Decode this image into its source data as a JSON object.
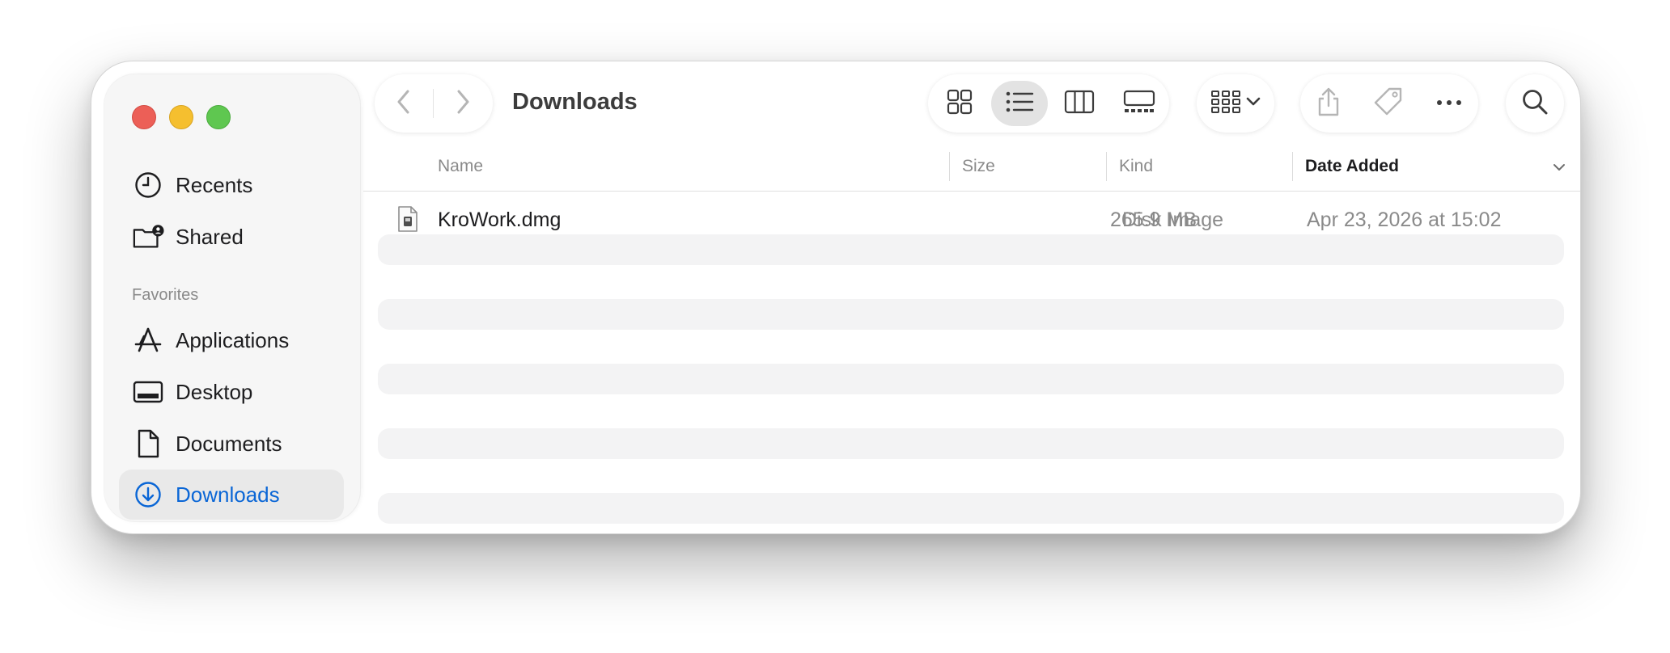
{
  "window": {
    "title": "Downloads"
  },
  "sidebar": {
    "items_top": [
      {
        "label": "Recents",
        "icon": "clock-icon"
      },
      {
        "label": "Shared",
        "icon": "shared-folder-icon"
      }
    ],
    "favorites_header": "Favorites",
    "favorites": [
      {
        "label": "Applications",
        "icon": "applications-icon"
      },
      {
        "label": "Desktop",
        "icon": "desktop-icon"
      },
      {
        "label": "Documents",
        "icon": "document-icon"
      },
      {
        "label": "Downloads",
        "icon": "downloads-icon",
        "selected": true
      }
    ]
  },
  "toolbar": {
    "view_modes": [
      "icon-view-icon",
      "list-view-icon",
      "column-view-icon",
      "gallery-view-icon"
    ],
    "selected_view": "list"
  },
  "table": {
    "columns": {
      "name": "Name",
      "size": "Size",
      "kind": "Kind",
      "date_added": "Date Added"
    },
    "sort_column": "date_added",
    "rows": [
      {
        "name": "KroWork.dmg",
        "size": "265.9 MB",
        "kind": "Disk Image",
        "date_added": "Apr 23, 2026 at 15:02"
      }
    ]
  },
  "colors": {
    "accent": "#0a66d6",
    "close": "#ec5f57",
    "minimize": "#f5bf2f",
    "maximize": "#5fc750"
  }
}
